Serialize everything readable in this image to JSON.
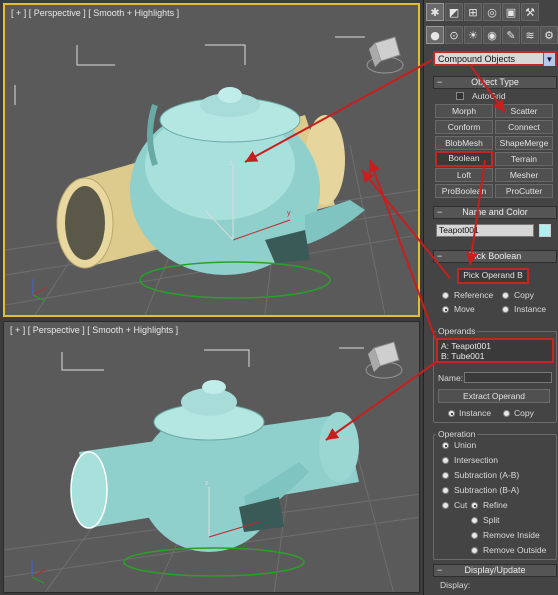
{
  "viewports": {
    "top": {
      "label": "[ + ] [ Perspective ] [ Smooth + Highlights ]"
    },
    "bottom": {
      "label": "[ + ] [ Perspective ] [ Smooth + Highlights ]"
    }
  },
  "panel": {
    "category_dropdown": "Compound Objects",
    "object_type": {
      "title": "Object Type",
      "autogrid": "AutoGrid",
      "buttons": [
        "Morph",
        "Scatter",
        "Conform",
        "Connect",
        "BlobMesh",
        "ShapeMerge",
        "Boolean",
        "Terrain",
        "Loft",
        "Mesher",
        "ProBoolean",
        "ProCutter"
      ]
    },
    "name_and_color": {
      "title": "Name and Color",
      "name": "Teapot001"
    },
    "pick_boolean": {
      "title": "Pick Boolean",
      "pick_button": "Pick Operand B",
      "reference": "Reference",
      "copy": "Copy",
      "move": "Move",
      "instance": "Instance"
    },
    "operands": {
      "title": "Operands",
      "items": [
        "A: Teapot001",
        "B: Tube001"
      ],
      "name_label": "Name:",
      "extract_button": "Extract Operand",
      "instance": "Instance",
      "copy": "Copy"
    },
    "operation": {
      "title": "Operation",
      "options": [
        "Union",
        "Intersection",
        "Subtraction (A-B)",
        "Subtraction (B-A)"
      ],
      "cut": "Cut",
      "cut_options": [
        "Refine",
        "Split",
        "Remove Inside",
        "Remove Outside"
      ]
    },
    "display_update": {
      "title": "Display/Update",
      "display_label": "Display:"
    }
  },
  "colors": {
    "teapot": "#9fd8d4",
    "tube": "#e6d49a",
    "annotation": "#c81e1e",
    "selection_border": "#e0c030"
  },
  "icons": [
    "create-icon",
    "modify-icon",
    "hierarchy-icon",
    "motion-icon",
    "display-icon",
    "utilities-icon",
    "geometry-icon",
    "shapes-icon",
    "lights-icon",
    "cameras-icon",
    "helpers-icon",
    "spacewarps-icon",
    "systems-icon"
  ]
}
